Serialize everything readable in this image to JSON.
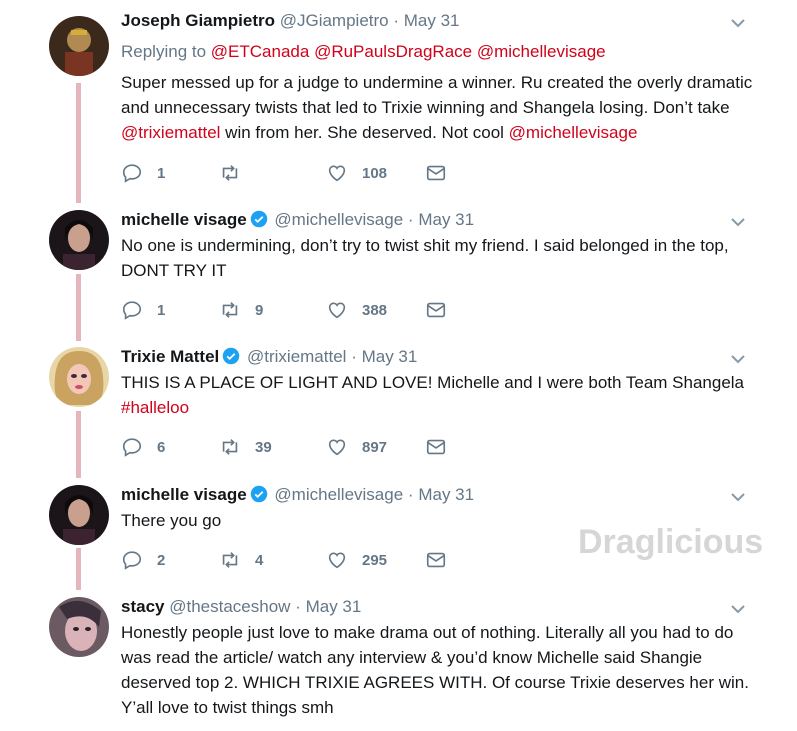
{
  "tweets": [
    {
      "name": "Joseph Giampietro",
      "handle": "@JGiampietro",
      "sep": "·",
      "date": "May 31",
      "replying_prefix": "Replying to",
      "replying_to": [
        "@ETCanada",
        "@RuPaulsDragRace",
        "@michellevisage"
      ],
      "text_parts": [
        "Super messed up for a judge to undermine a winner. Ru created the overly dramatic and unnecessary twists that led to Trixie winning and Shangela losing. Don’t take ",
        "@trixiemattel",
        " win from her. She deserved. Not cool ",
        "@michellevisage"
      ],
      "replies": "1",
      "retweets": "",
      "likes": "108",
      "avatar_colors": [
        "#3b2a1c",
        "#b08a52",
        "#7a3422"
      ]
    },
    {
      "name": "michelle visage",
      "handle": "@michellevisage",
      "sep": "·",
      "date": "May 31",
      "verified": true,
      "text": "No one is undermining, don’t try to twist shit my friend. I said belonged in the top, DONT TRY IT",
      "replies": "1",
      "retweets": "9",
      "likes": "388",
      "avatar_colors": [
        "#1b1418",
        "#c9a08d",
        "#3b2430"
      ]
    },
    {
      "name": "Trixie Mattel",
      "handle": "@trixiemattel",
      "sep": "·",
      "date": "May 31",
      "verified": true,
      "text_parts": [
        "THIS IS A PLACE OF LIGHT AND LOVE! Michelle and I were both Team Shangela ",
        "#halleloo"
      ],
      "replies": "6",
      "retweets": "39",
      "likes": "897",
      "avatar_colors": [
        "#e9d6a8",
        "#f2c7b7",
        "#c9a35f"
      ]
    },
    {
      "name": "michelle visage",
      "handle": "@michellevisage",
      "sep": "·",
      "date": "May 31",
      "verified": true,
      "text": "There you go",
      "replies": "2",
      "retweets": "4",
      "likes": "295",
      "avatar_colors": [
        "#1b1418",
        "#c9a08d",
        "#3b2430"
      ]
    },
    {
      "name": "stacy",
      "handle": "@thestaceshow",
      "sep": "·",
      "date": "May 31",
      "text": "Honestly people just love to make drama out of nothing. Literally all you had to do was read the article/ watch any interview & you’d know Michelle said Shangie deserved top 2. WHICH TRIXIE AGREES WITH. Of course Trixie deserves her win. Y’all love to twist things smh",
      "avatar_colors": [
        "#6c5a63",
        "#d9b3b8",
        "#3a2f3a"
      ]
    }
  ],
  "watermark": "Draglicious",
  "colors": {
    "link": "#d0021b",
    "secondary_text": "#657786",
    "thread_line": "#e6b6bd",
    "verified": "#1da1f2",
    "icon": "#657786"
  },
  "icons": {
    "reply": "reply-icon",
    "retweet": "retweet-icon",
    "like": "heart-icon",
    "dm": "envelope-icon",
    "more": "chevron-down-icon",
    "verified": "verified-badge-icon"
  }
}
